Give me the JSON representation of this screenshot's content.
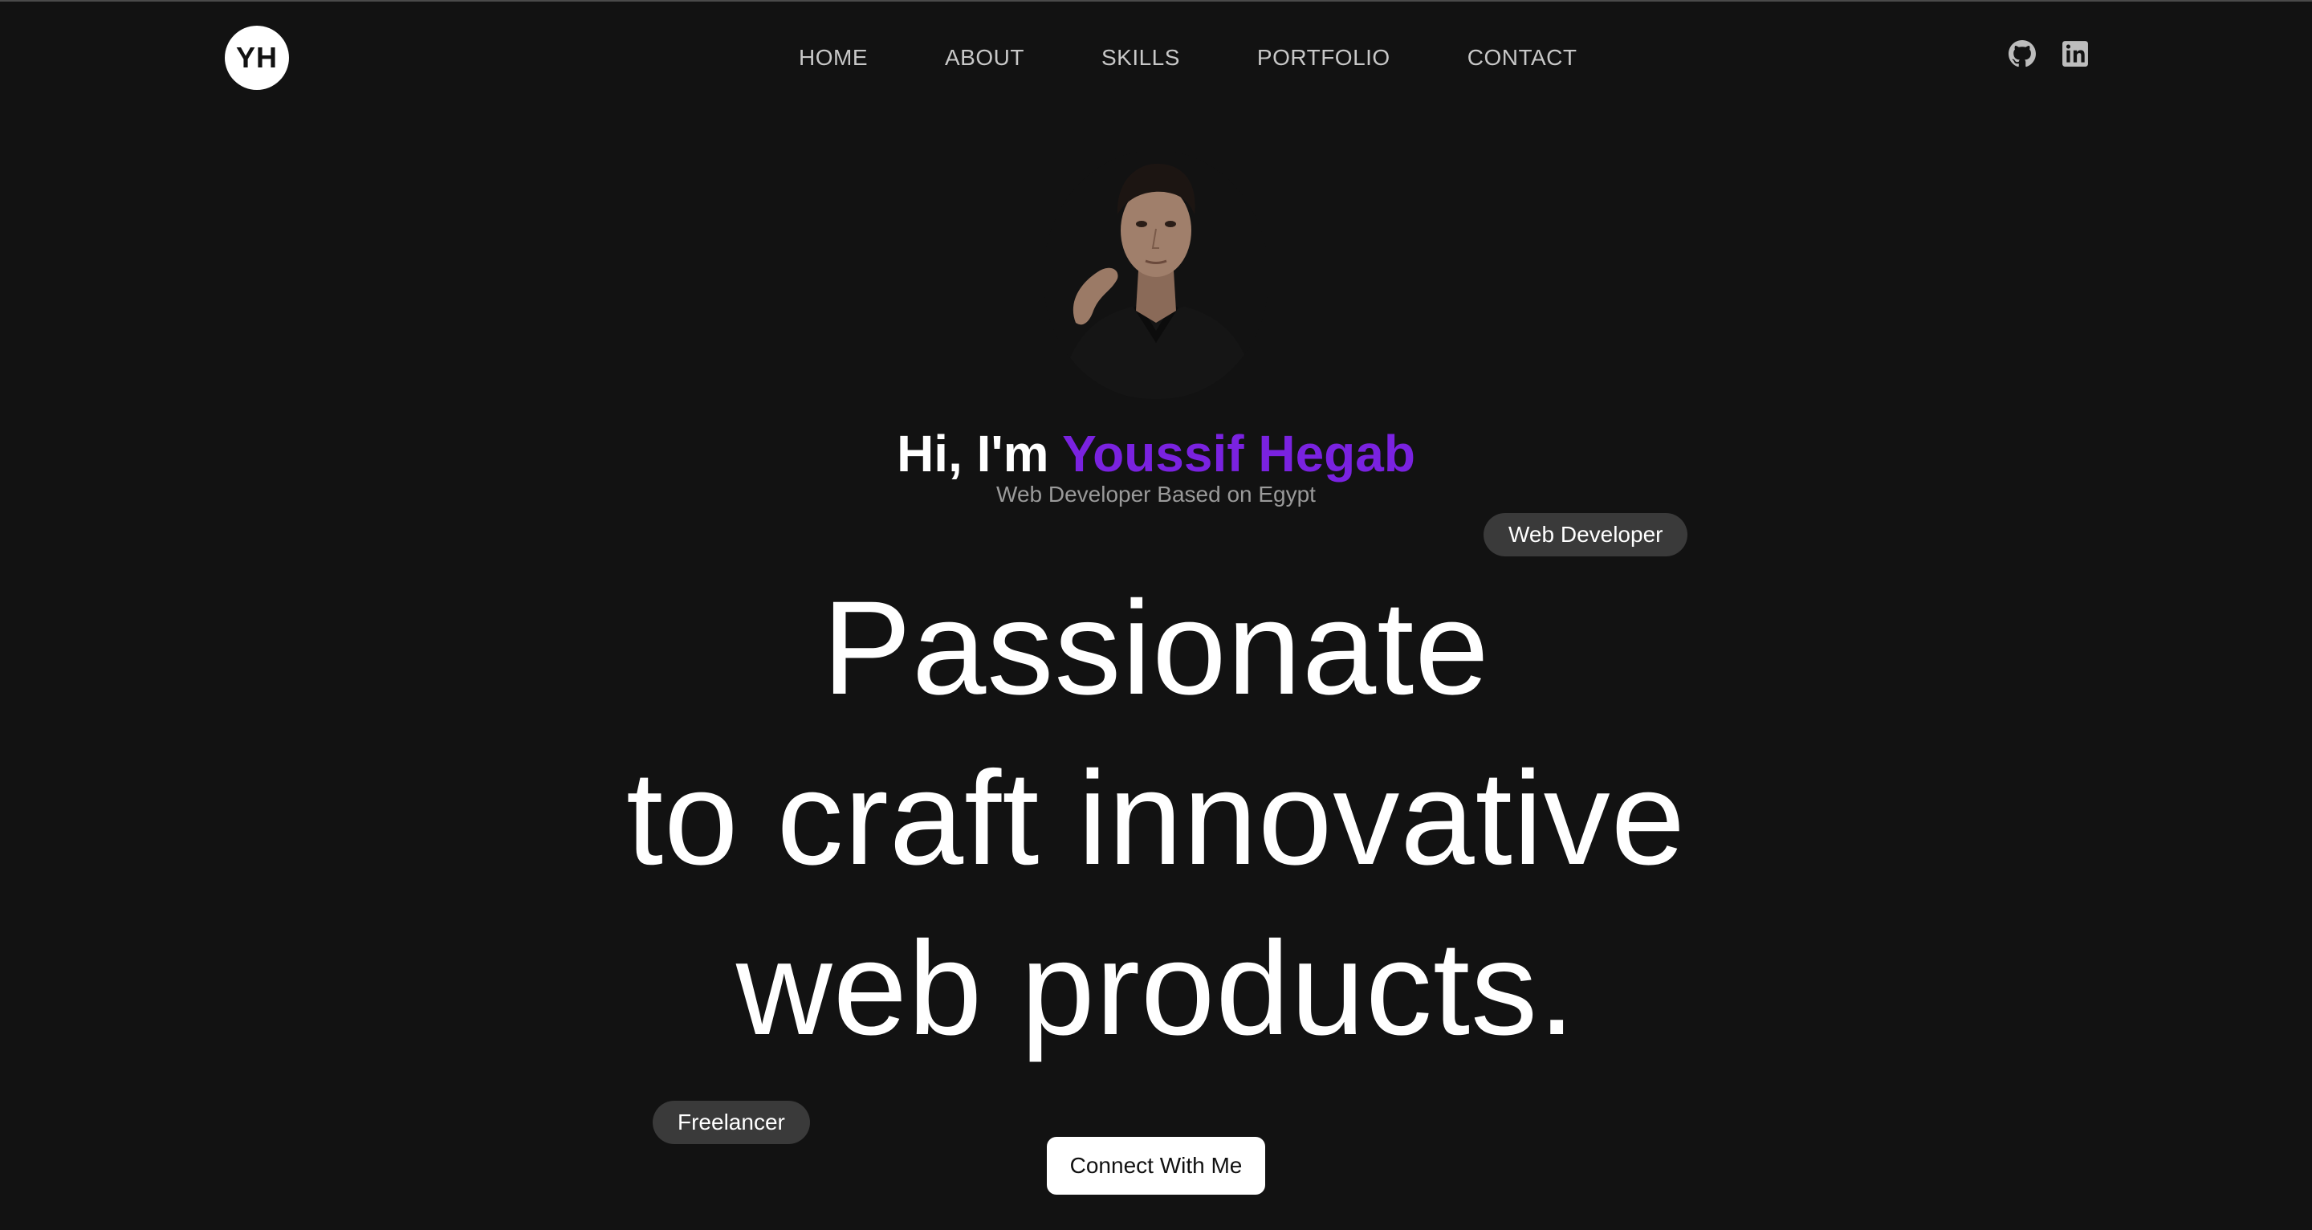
{
  "logo": {
    "text": "YH"
  },
  "nav": {
    "items": [
      {
        "label": "HOME"
      },
      {
        "label": "ABOUT"
      },
      {
        "label": "SKILLS"
      },
      {
        "label": "PORTFOLIO"
      },
      {
        "label": "CONTACT"
      }
    ]
  },
  "social": {
    "icons": [
      "github-icon",
      "linkedin-icon"
    ]
  },
  "hero": {
    "greeting_prefix": "Hi, I'm ",
    "name": "Youssif Hegab",
    "subtitle": "Web Developer Based on Egypt",
    "badge_right": "Web Developer",
    "badge_left": "Freelancer",
    "headline": {
      "line1": "Passionate",
      "line2": "to craft innovative",
      "line3": "web products."
    },
    "cta_label": "Connect With Me"
  },
  "colors": {
    "background": "#121212",
    "accent": "#7a22e0",
    "badge": "#3a3a3a",
    "nav_text": "#c8c8c8",
    "muted_text": "#9a9a9a"
  }
}
